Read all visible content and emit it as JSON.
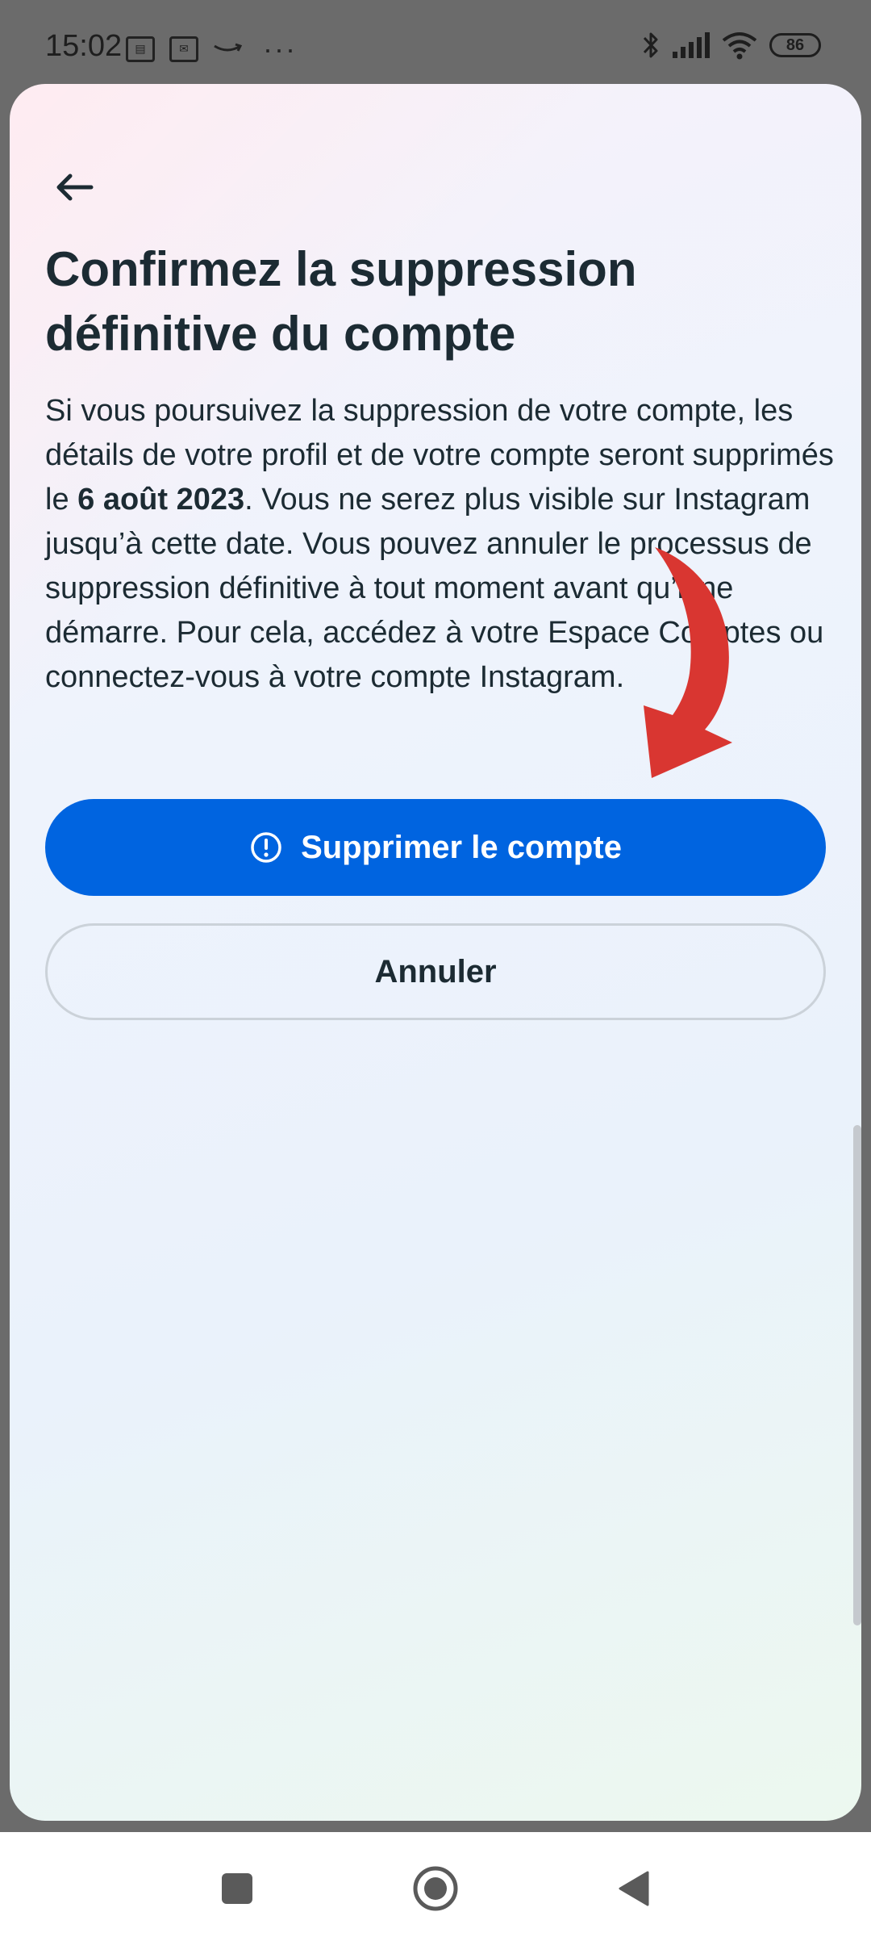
{
  "status_bar": {
    "time": "15:02",
    "battery": "86",
    "icons": [
      "notification-icon-1",
      "notification-icon-2",
      "amazon-icon",
      "more-dots-icon",
      "bluetooth-icon",
      "signal-icon",
      "wifi-icon",
      "battery-icon"
    ]
  },
  "sheet": {
    "title": "Confirmez la suppression définitive du compte",
    "body_before_date": "Si vous poursuivez la suppression de votre compte, les détails de votre profil et de votre compte seront supprimés le ",
    "body_date": "6 août 2023",
    "body_after_date": ". Vous ne serez plus visible sur Instagram jusqu’à cette date. Vous pouvez annuler le processus de suppression définitive à tout moment avant qu’il ne démarre. Pour cela, accédez à votre Espace Comptes ou connectez-vous à votre compte Instagram.",
    "primary_button": "Supprimer le compte",
    "secondary_button": "Annuler"
  },
  "colors": {
    "primary": "#0064e0",
    "text": "#1c2b33",
    "annotation_arrow": "#d93631"
  },
  "nav_bar": {
    "items": [
      "recents-square-icon",
      "home-circle-icon",
      "back-triangle-icon"
    ]
  }
}
